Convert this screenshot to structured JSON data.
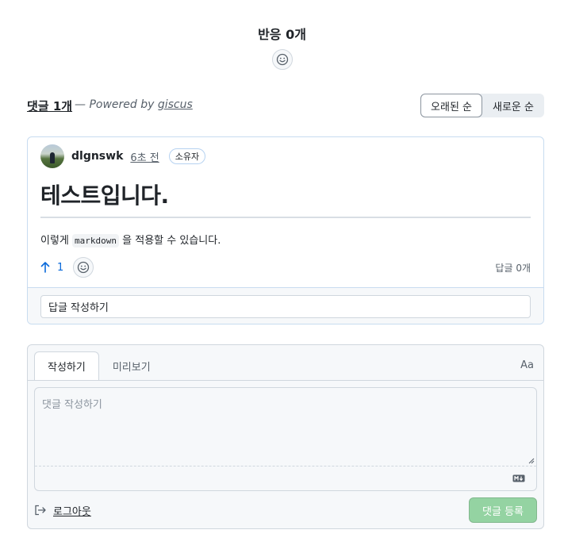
{
  "reactions": {
    "title": "반응 0개"
  },
  "comments_header": {
    "count_label": "댓글 1개",
    "powered_prefix": "— Powered by",
    "powered_link": "giscus",
    "sort": {
      "oldest": "오래된 순",
      "newest": "새로운 순"
    }
  },
  "comment": {
    "author": "dlgnswk",
    "time": "6초 전",
    "badge": "소유자",
    "heading": "테스트입니다.",
    "text_before": "이렇게",
    "code": "markdown",
    "text_after": "을 적용할 수 있습니다.",
    "upvotes": "1",
    "reply_count": "답글 0개",
    "reply_placeholder": "답글 작성하기"
  },
  "composer": {
    "tabs": {
      "write": "작성하기",
      "preview": "미리보기"
    },
    "font_toggle": "Aa",
    "placeholder": "댓글 작성하기",
    "logout": "로그아웃",
    "submit": "댓글 등록"
  },
  "colors": {
    "accent": "#0969da",
    "submit_disabled": "#94d3a2",
    "card_border": "#c8dcf0"
  }
}
